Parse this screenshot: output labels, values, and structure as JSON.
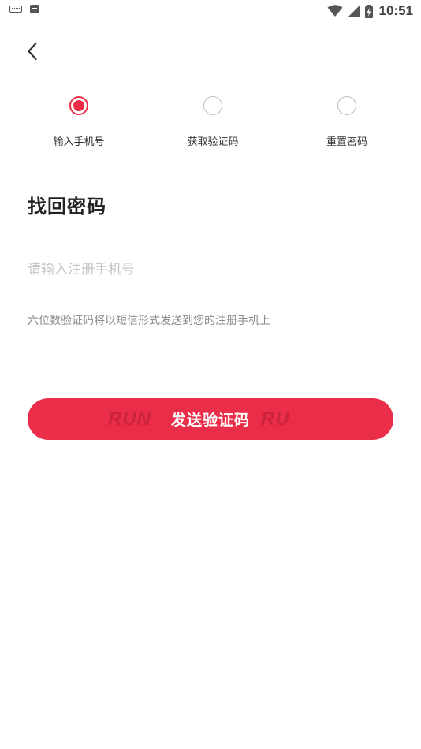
{
  "status_bar": {
    "time": "10:51",
    "left_icons": [
      "keyboard-icon",
      "sim-card-icon"
    ],
    "right_icons": [
      "wifi-icon",
      "signal-icon",
      "battery-charging-icon"
    ]
  },
  "nav": {
    "back_icon": "chevron-left-icon"
  },
  "steps": [
    {
      "label": "输入手机号",
      "state": "active"
    },
    {
      "label": "获取验证码",
      "state": "inactive"
    },
    {
      "label": "重置密码",
      "state": "inactive"
    }
  ],
  "title": "找回密码",
  "phone_input": {
    "placeholder": "请输入注册手机号",
    "value": ""
  },
  "hint": "六位数验证码将以短信形式发送到您的注册手机上",
  "send_button": {
    "label": "发送验证码",
    "watermark_left": "RUN",
    "watermark_right": "RU"
  },
  "colors": {
    "accent": "#EA2D49",
    "placeholder": "#C4C4C4",
    "hint": "#8A8A8A"
  }
}
